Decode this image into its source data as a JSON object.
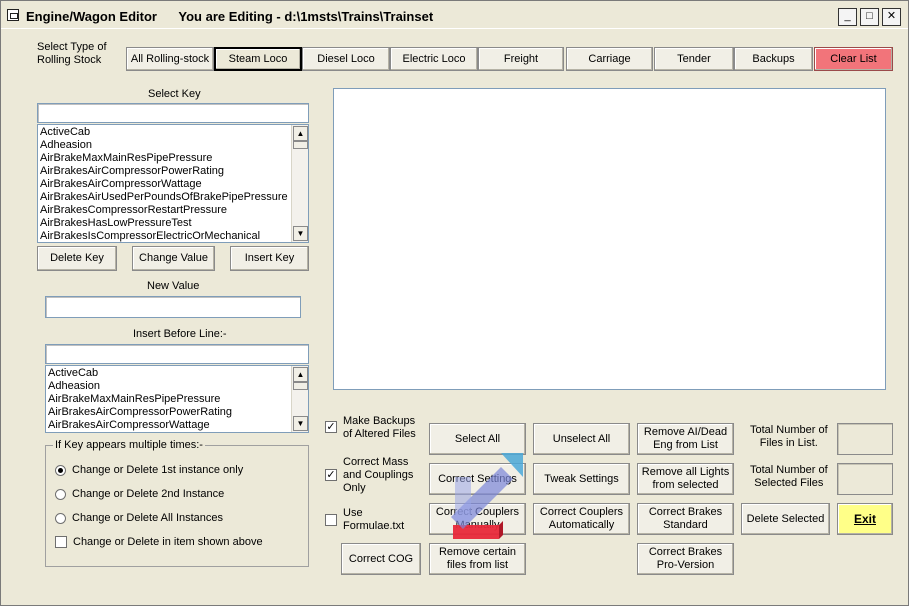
{
  "window": {
    "title": "Engine/Wagon Editor      You are Editing - d:\\1msts\\Trains\\Trainset",
    "minimize_glyph": "_",
    "maximize_glyph": "□",
    "close_glyph": "✕"
  },
  "stock_type": {
    "label": "Select Type of\nRolling Stock",
    "buttons": [
      "All Rolling-stock",
      "Steam Loco",
      "Diesel Loco",
      "Electric Loco",
      "Freight",
      "Carriage",
      "Tender",
      "Backups",
      "Clear List"
    ],
    "selected": "Steam Loco"
  },
  "select_key": {
    "label": "Select Key",
    "input_value": "",
    "items": [
      "ActiveCab",
      "Adheasion",
      "AirBrakeMaxMainResPipePressure",
      "AirBrakesAirCompressorPowerRating",
      "AirBrakesAirCompressorWattage",
      "AirBrakesAirUsedPerPoundsOfBrakePipePressure",
      "AirBrakesCompressorRestartPressure",
      "AirBrakesHasLowPressureTest",
      "AirBrakesIsCompressorElectricOrMechanical"
    ]
  },
  "key_buttons": {
    "delete": "Delete Key",
    "change": "Change Value",
    "insert": "Insert Key"
  },
  "new_value": {
    "label": "New Value",
    "value": ""
  },
  "insert_before": {
    "label": "Insert Before Line:-",
    "input_value": "",
    "items": [
      "ActiveCab",
      "Adheasion",
      "AirBrakeMaxMainResPipePressure",
      "AirBrakesAirCompressorPowerRating",
      "AirBrakesAirCompressorWattage"
    ]
  },
  "multiple_group": {
    "legend": "If Key appears multiple times:-",
    "options": [
      "Change or Delete 1st instance only",
      "Change or Delete 2nd Instance",
      "Change or Delete All Instances"
    ],
    "selected_index": 0,
    "checkbox_label": "Change or Delete in item shown above",
    "checkbox_checked": false
  },
  "options": {
    "make_backups": {
      "label": "Make Backups\nof Altered Files",
      "checked": true
    },
    "correct_mass": {
      "label": "Correct Mass\nand Couplings\nOnly",
      "checked": true
    },
    "use_formulae": {
      "label": "Use\nFormulae.txt",
      "checked": false
    }
  },
  "action_buttons": {
    "select_all": "Select All",
    "unselect_all": "Unselect All",
    "remove_ai": "Remove AI/Dead\nEng from List",
    "correct_settings": "Correct Settings",
    "tweak_settings": "Tweak Settings",
    "remove_lights": "Remove all Lights\nfrom selected",
    "correct_couplers_manually": "Correct Couplers\nManually",
    "correct_couplers_auto": "Correct Couplers\nAutomatically",
    "correct_brakes_standard": "Correct Brakes\nStandard",
    "delete_selected": "Delete Selected",
    "correct_cog": "Correct COG",
    "remove_certain": "Remove certain\nfiles from list",
    "correct_brakes_pro": "Correct Brakes\nPro-Version",
    "exit": "Exit"
  },
  "totals": {
    "total_files_label": "Total Number of\nFiles in List.",
    "total_files_value": "",
    "selected_files_label": "Total Number of\nSelected Files",
    "selected_files_value": ""
  },
  "colors": {
    "clear_list": "#f2747a",
    "exit": "#ffff88",
    "cursor_blue": "#7a86d8",
    "cursor_red": "#e8283a"
  }
}
